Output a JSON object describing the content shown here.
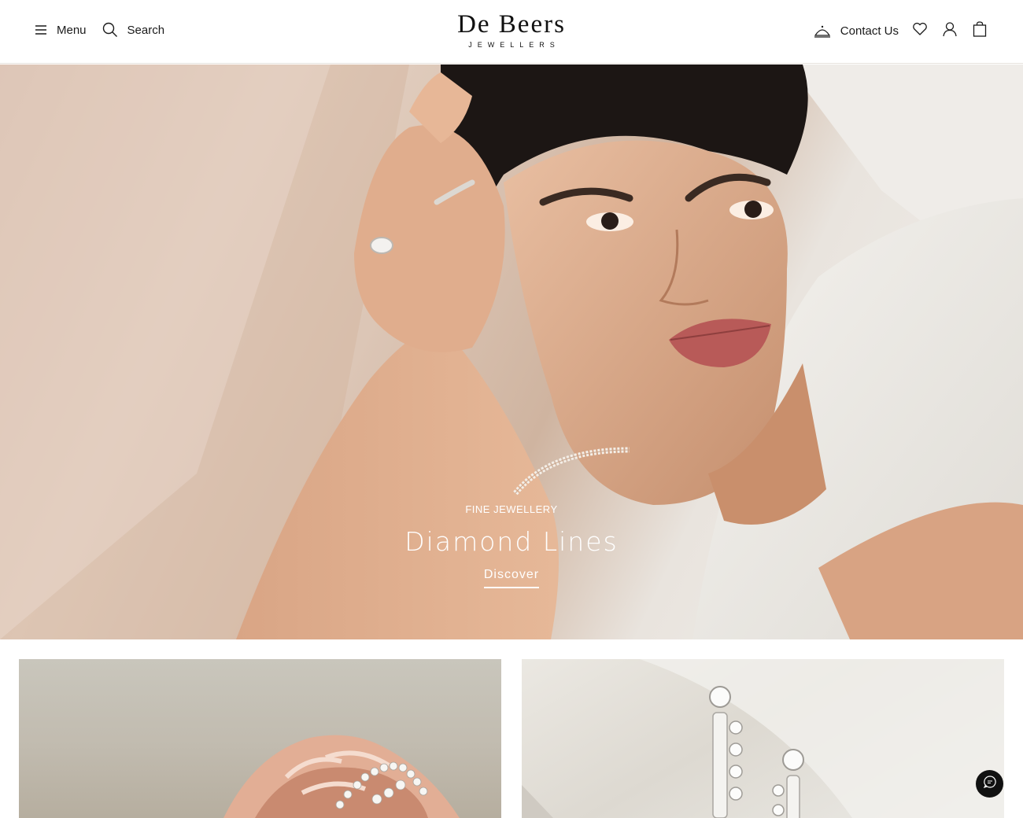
{
  "header": {
    "menu_label": "Menu",
    "search_label": "Search",
    "logo_main": "De Beers",
    "logo_sub": "JEWELLERS",
    "contact_label": "Contact Us",
    "icons": [
      "menu-icon",
      "search-icon",
      "concierge-icon",
      "heart-icon",
      "account-icon",
      "bag-icon"
    ]
  },
  "hero": {
    "eyebrow": "FINE JEWELLERY",
    "title": "Diamond Lines",
    "cta": "Discover"
  },
  "chat": {
    "icon": "chat-icon"
  },
  "colors": {
    "text": "#1a1a1a",
    "hero_text": "#ffffff",
    "chat_bg": "#111111"
  }
}
